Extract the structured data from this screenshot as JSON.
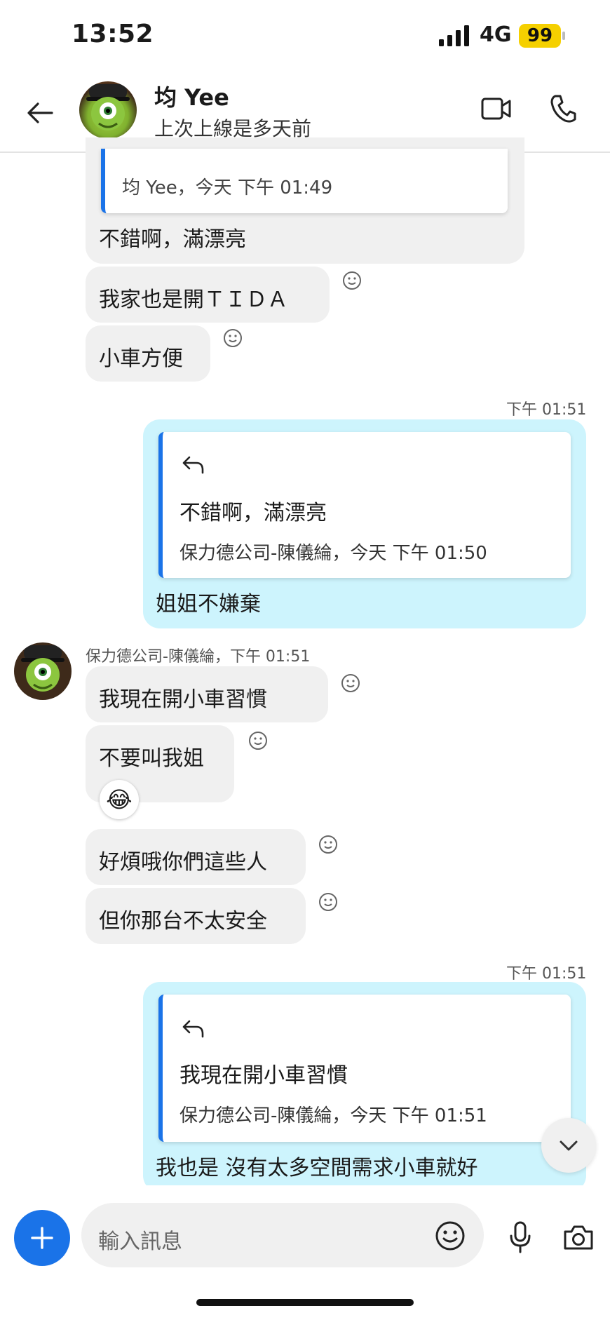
{
  "status_bar": {
    "time": "13:52",
    "network": "4G",
    "battery": "99"
  },
  "header": {
    "name": "均 Yee",
    "status": "上次上線是多天前"
  },
  "conversation": {
    "top_partial": {
      "quote_author": "均 Yee，今天 下午 01:49",
      "text": "不錯啊，滿漂亮"
    },
    "msg_tida": "我家也是開ＴＩＤＡ",
    "msg_small_car": "小車方便",
    "out1": {
      "time": "下午 01:51",
      "quote_text": "不錯啊，滿漂亮",
      "quote_author": "保力德公司-陳儀綸，今天 下午 01:50",
      "text": "姐姐不嫌棄"
    },
    "in_group": {
      "sender": "保力德公司-陳儀綸，下午 01:51",
      "msgs": [
        "我現在開小車習慣",
        "不要叫我姐",
        "好煩哦你們這些人",
        "但你那台不太安全"
      ],
      "reaction": "😂"
    },
    "out2": {
      "time": "下午 01:51",
      "quote_text": "我現在開小車習慣",
      "quote_author": "保力德公司-陳儀綸，今天 下午 01:51",
      "text": "我也是 沒有太多空間需求小車就好"
    }
  },
  "input": {
    "placeholder": "輸入訊息"
  }
}
